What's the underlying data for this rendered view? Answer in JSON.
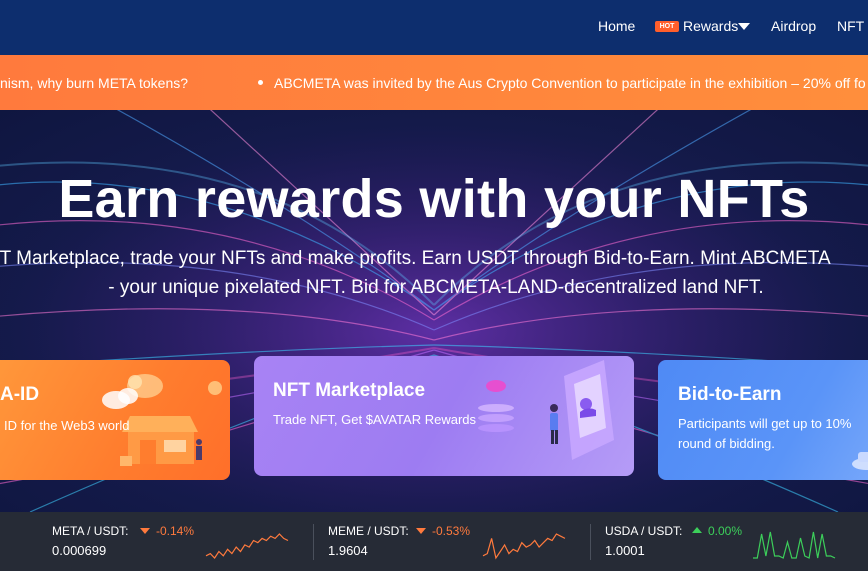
{
  "nav": {
    "items": [
      {
        "label": "Home"
      },
      {
        "label": "Rewards",
        "badge": "HOT"
      },
      {
        "label": "Airdrop"
      },
      {
        "label": "NFT M"
      }
    ]
  },
  "ticker": {
    "items": [
      "nism, why burn META tokens?",
      "ABCMETA was invited by the Aus Crypto Convention to participate in the exhibition – 20% off fo"
    ]
  },
  "hero": {
    "title": "Earn rewards with your NFTs",
    "subtitle_line1": "FT Marketplace, trade your NFTs and make profits. Earn USDT through Bid-to-Earn. Mint ABCMETA",
    "subtitle_line2": "- your unique pixelated NFT. Bid for ABCMETA-LAND-decentralized land NFT."
  },
  "cards": [
    {
      "title": "A-ID",
      "desc": "ID for the Web3 world"
    },
    {
      "title": "NFT Marketplace",
      "desc": "Trade NFT, Get $AVATAR Rewards"
    },
    {
      "title": "Bid-to-Earn",
      "desc_line1": "Participants will get up to 10%",
      "desc_line2": "round of bidding."
    }
  ],
  "market": [
    {
      "pair": "META / USDT:",
      "change": "-0.14%",
      "price": "0.000699",
      "direction": "down",
      "color": "#ff7a3d",
      "spark": [
        5,
        6,
        4,
        7,
        5,
        8,
        6,
        9,
        7,
        10,
        9,
        12,
        11,
        13,
        12,
        14,
        13,
        15,
        13,
        12
      ]
    },
    {
      "pair": "MEME / USDT:",
      "change": "-0.53%",
      "price": "1.9604",
      "direction": "down",
      "color": "#ff7a3d",
      "spark": [
        4,
        5,
        12,
        3,
        6,
        9,
        5,
        7,
        6,
        10,
        8,
        9,
        11,
        8,
        10,
        12,
        11,
        14,
        13,
        12
      ]
    },
    {
      "pair": "USDA / USDT:",
      "change": "0.00%",
      "price": "1.0001",
      "direction": "up",
      "color": "#3ccf5a",
      "spark": [
        2,
        2,
        14,
        3,
        15,
        3,
        3,
        2,
        10,
        2,
        2,
        12,
        3,
        2,
        15,
        2,
        14,
        3,
        3,
        2
      ]
    }
  ],
  "colors": {
    "nav_bg": "#0d2e6e",
    "ticker_bg": "#ff8a3c",
    "hot_badge": "#ff5e2b",
    "down": "#ff7a3d",
    "up": "#3ccf5a",
    "market_bg": "#262b36"
  }
}
